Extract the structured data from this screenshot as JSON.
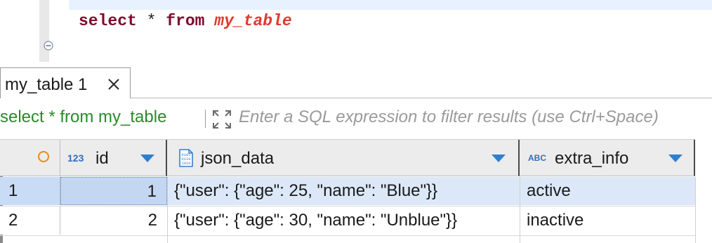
{
  "editor": {
    "tokens": {
      "kw_select": "select",
      "op_star": "*",
      "kw_from": "from",
      "table": "my_table"
    }
  },
  "results_tab": {
    "label": "my_table 1",
    "close_icon": "close-icon"
  },
  "filter": {
    "query": "select * from my_table",
    "placeholder": "Enter a SQL expression to filter results (use Ctrl+Space)"
  },
  "grid": {
    "columns": [
      {
        "type_badge": "123",
        "name": "id"
      },
      {
        "type_icon": "json-doc-icon",
        "name": "json_data"
      },
      {
        "type_badge": "ABC",
        "name": "extra_info"
      }
    ],
    "rows": [
      {
        "num": "1",
        "id": "1",
        "json_data": "{\"user\": {\"age\": 25, \"name\": \"Blue\"}}",
        "extra_info": "active"
      },
      {
        "num": "2",
        "id": "2",
        "json_data": "{\"user\": {\"age\": 30, \"name\": \"Unblue\"}}",
        "extra_info": "inactive"
      }
    ]
  },
  "colors": {
    "keyword": "#7f0a2e",
    "table_name": "#e0392f",
    "filter_query": "#2a8a2a",
    "accent": "#2f7fd0",
    "selected_row": "#dce8f8"
  }
}
